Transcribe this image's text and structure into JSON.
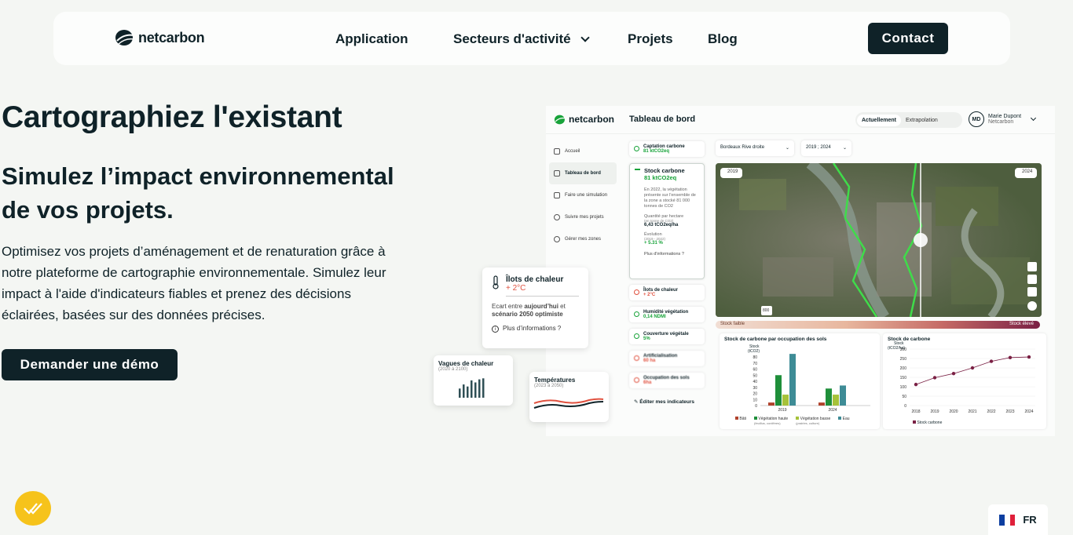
{
  "nav": {
    "logo": "netcarbon",
    "links": [
      "Application",
      "Secteurs d'activité",
      "Projets",
      "Blog"
    ],
    "contact": "Contact"
  },
  "hero": {
    "title": "Cartographiez l'existant",
    "subtitle": "Simulez l’impact environnemental de vos projets.",
    "paragraph": "Optimisez vos projets d’aménagement et de renaturation grâce à notre plateforme de cartographie environnementale. Simulez leur impact à l'aide d'indicateurs fiables et prenez des décisions éclairées, basées sur des données précises.",
    "cta": "Demander une démo"
  },
  "dashboard": {
    "logo": "netcarbon",
    "title": "Tableau de bord",
    "toggle": [
      "Actuellement",
      "Extrapolation"
    ],
    "user": {
      "initials": "MD",
      "name": "Marie Dupont",
      "org": "Netcarbon"
    },
    "sidebar": [
      "Accueil",
      "Tableau de bord",
      "Faire une simulation",
      "Suivre mes projets",
      "Gérer mes zones"
    ],
    "indicators": {
      "captation": {
        "title": "Captation carbone",
        "value": "81 ktCO2eq"
      },
      "stock": {
        "title": "Stock carbone",
        "value": "81 ktCO2eq",
        "desc": "En 2022, la végétation présente sur l'ensemble de la zone a stocké 81 000 tonnes de CO2",
        "per_ha_label": "Quantité par hectare",
        "per_ha_unit": "(en tonne de CO2)",
        "per_ha_value": "6,43 tCO2eq/ha",
        "evo_label": "Évolution",
        "evo_range": "(2019 - 2022)",
        "evo_value": "+ 5.31 %",
        "more": "Plus d'informations ?"
      },
      "ilots": {
        "title": "Îlots de chaleur",
        "value": "+ 2°C"
      },
      "humidite": {
        "title": "Humidité végétation",
        "value": "0,14 NDMI"
      },
      "couverture": {
        "title": "Couverture végétale",
        "value": "5%"
      },
      "artificialisation": {
        "title": "Artificialisation",
        "value": "60 ha"
      },
      "occupation": {
        "title": "Occupation des sols",
        "value": "6ha"
      },
      "edit": "Éditer mes indicateurs"
    },
    "selects": {
      "zone": "Bordeaux Rive droite",
      "years": "2019 ; 2024"
    },
    "map": {
      "left_year": "2019",
      "right_year": "2024",
      "scale": "800"
    },
    "legend": {
      "low": "Stock faible",
      "high": "Stock élevé"
    },
    "chart_bars": {
      "title": "Stock de carbone par occupation des sols",
      "ylabel": "Stock",
      "yunit": "(tCO2)",
      "legend": [
        "Bâti",
        "Végétation haute",
        "Végétation basse",
        "Eau"
      ],
      "legend_sub": [
        "",
        "(feuillus, conifères)",
        "(prairies, culture)",
        ""
      ]
    },
    "chart_line": {
      "title": "Stock de carbone",
      "ylabel": "Stock",
      "yunit": "(tCO2/ha)",
      "legend": "Stock carbone"
    }
  },
  "chart_data": [
    {
      "type": "bar",
      "title": "Stock de carbone par occupation des sols",
      "ylabel": "Stock (tCO2)",
      "categories": [
        "2019",
        "2024"
      ],
      "ylim": [
        0,
        80
      ],
      "yticks": [
        0,
        10,
        20,
        30,
        40,
        50,
        60,
        70,
        80
      ],
      "series": [
        {
          "name": "Bâti",
          "values": [
            5,
            5
          ],
          "color": "#b0422c"
        },
        {
          "name": "Végétation haute",
          "values": [
            50,
            28
          ],
          "color": "#1f8f3a"
        },
        {
          "name": "Végétation basse",
          "values": [
            18,
            18
          ],
          "color": "#a6c23a"
        },
        {
          "name": "Eau",
          "values": [
            85,
            33
          ],
          "color": "#3e8c96"
        }
      ]
    },
    {
      "type": "line",
      "title": "Stock de carbone",
      "ylabel": "Stock (tCO2/ha)",
      "x": [
        "2018",
        "2019",
        "2020",
        "2021",
        "2022",
        "2023",
        "2024"
      ],
      "ylim": [
        0,
        300
      ],
      "yticks": [
        0,
        50,
        100,
        150,
        200,
        250,
        300
      ],
      "series": [
        {
          "name": "Stock carbone",
          "values": [
            112,
            148,
            170,
            200,
            235,
            255,
            258
          ],
          "color": "#7a2044"
        }
      ]
    }
  ],
  "cards": {
    "ilots": {
      "title": "Îlots de chaleur",
      "value": "+ 2°C",
      "text_pre": "Ecart entre ",
      "text_b1": "aujourd’hui",
      "text_mid": " et ",
      "text_b2": "scénario 2050 optimiste",
      "more": "Plus d’informations ?"
    },
    "vagues": {
      "title": "Vagues de chaleur",
      "range": "(2020 à 2100)",
      "bars": [
        0.45,
        0.65,
        0.55,
        0.85,
        0.75,
        0.9,
        0.95
      ]
    },
    "temps": {
      "title": "Températures",
      "range": "(2023 à 2050)"
    }
  },
  "lang": "FR",
  "colors": {
    "dark": "#0f2228",
    "green": "#18a33a",
    "yellow": "#f6c31b",
    "bg": "#f4f6f3"
  }
}
